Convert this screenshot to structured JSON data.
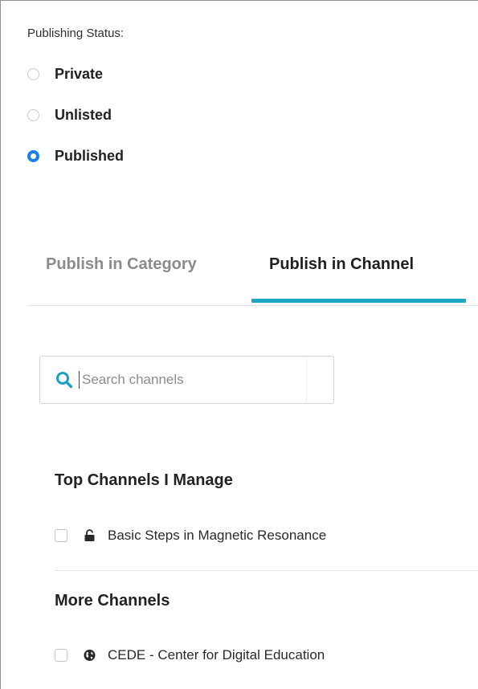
{
  "publishing_status": {
    "label": "Publishing Status:",
    "options": [
      {
        "label": "Private",
        "checked": false
      },
      {
        "label": "Unlisted",
        "checked": false
      },
      {
        "label": "Published",
        "checked": true
      }
    ]
  },
  "tabs": [
    {
      "label": "Publish in Category",
      "active": false
    },
    {
      "label": "Publish in Channel",
      "active": true
    }
  ],
  "search": {
    "placeholder": "Search channels",
    "value": "",
    "icon": "search-icon"
  },
  "top_channels": {
    "title": "Top Channels I Manage",
    "items": [
      {
        "label": "Basic Steps in Magnetic Resonance",
        "icon": "lock-open-icon",
        "checked": false
      }
    ]
  },
  "more_channels": {
    "title": "More Channels",
    "items": [
      {
        "label": "CEDE - Center for Digital Education",
        "icon": "globe-icon",
        "checked": false
      }
    ]
  },
  "colors": {
    "accent": "#1a7fe8",
    "tab_underline": "#1ea7c5",
    "search_icon": "#1aa1bf"
  }
}
